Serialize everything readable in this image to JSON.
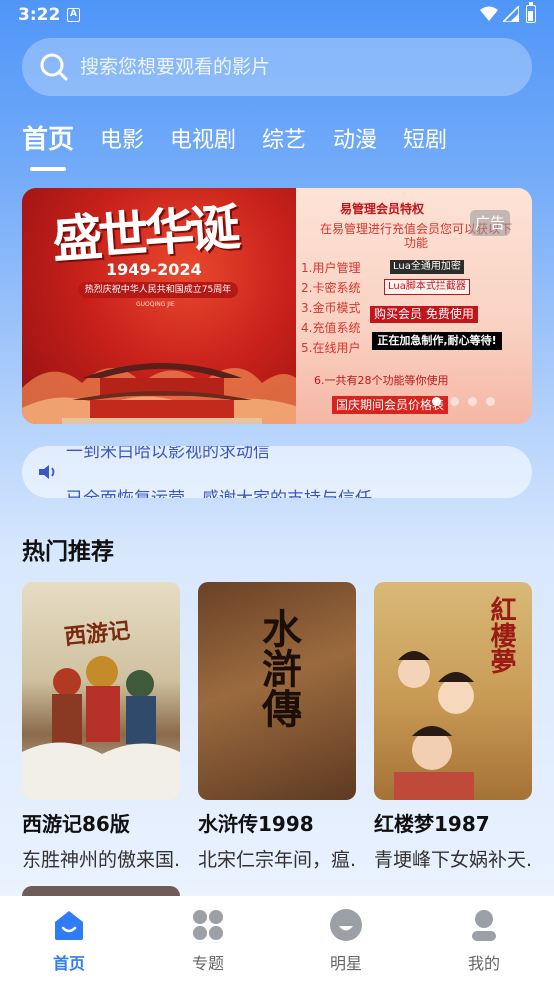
{
  "status_bar": {
    "time": "3:22",
    "indicator": "A"
  },
  "search": {
    "placeholder": "搜索您想要观看的影片"
  },
  "tabs": [
    {
      "label": "首页",
      "active": true
    },
    {
      "label": "电影",
      "active": false
    },
    {
      "label": "电视剧",
      "active": false
    },
    {
      "label": "综艺",
      "active": false
    },
    {
      "label": "动漫",
      "active": false
    },
    {
      "label": "短剧",
      "active": false
    }
  ],
  "banner": {
    "left_title": "盛世华诞",
    "left_years": "1949-2024",
    "left_subtitle": "热烈庆祝中华人民共和国成立75周年",
    "left_pinyin": "GUOQING JIE",
    "promo_heading": "易管理会员特权",
    "promo_intro": "在易管理进行充值会员您可以获以下功能",
    "promo_items": [
      "1.用户管理",
      "2.卡密系统",
      "3.金币模式",
      "4.充值系统",
      "5.在线用户"
    ],
    "promo_tag_1": "Lua全通用加密",
    "promo_tag_2": "Lua脚本式拦截器",
    "promo_buy": "购买会员 免费使用",
    "promo_building": "正在加急制作,耐心等待!",
    "promo_total": "6.一共有28个功能等你使用",
    "promo_price": "国庆期间会员价格表",
    "ad_label": "广告",
    "dots": 4,
    "active_dot": 0
  },
  "notice": {
    "line_1": "一到米白哈以影视的求动信",
    "line_2": "已全面恢复运营，感谢大家的支持与信任"
  },
  "section": {
    "title": "热门推荐"
  },
  "recommendations": [
    {
      "title": "西游记86版",
      "desc": "东胜神州的傲来国...",
      "poster_text": "西游记"
    },
    {
      "title": "水浒传1998",
      "desc": "北宋仁宗年间，瘟...",
      "poster_text": "水滸傳"
    },
    {
      "title": "红楼梦1987",
      "desc": "青埂峰下女娲补天...",
      "poster_text": "紅樓夢"
    }
  ],
  "bottom_nav": [
    {
      "label": "首页",
      "icon": "home-icon",
      "active": true
    },
    {
      "label": "专题",
      "icon": "grid-icon",
      "active": false
    },
    {
      "label": "明星",
      "icon": "star-face-icon",
      "active": false
    },
    {
      "label": "我的",
      "icon": "user-icon",
      "active": false
    }
  ],
  "colors": {
    "accent": "#2f7cf6",
    "notice_text": "#3a57c4"
  }
}
